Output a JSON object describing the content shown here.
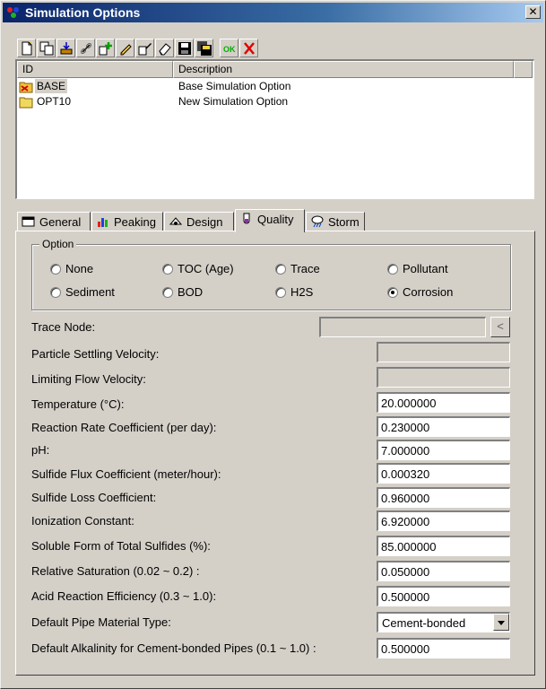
{
  "window": {
    "title": "Simulation Options",
    "close_label": "✕"
  },
  "toolbar": {
    "buttons": [
      {
        "icon": "new-icon"
      },
      {
        "icon": "copy-icon"
      },
      {
        "icon": "import-icon"
      },
      {
        "icon": "link-icon"
      },
      {
        "icon": "add-icon"
      },
      {
        "icon": "edit-icon"
      },
      {
        "icon": "rename-icon"
      },
      {
        "icon": "erase-icon"
      },
      {
        "icon": "save-icon"
      },
      {
        "icon": "save-all-icon"
      },
      {
        "icon": "ok-icon"
      },
      {
        "icon": "delete-icon"
      }
    ],
    "ok_label": "OK"
  },
  "list": {
    "columns": [
      "ID",
      "Description"
    ],
    "rows": [
      {
        "id": "BASE",
        "description": "Base Simulation Option",
        "icon": "base-folder-icon",
        "selected": true
      },
      {
        "id": "OPT10",
        "description": "New Simulation Option",
        "icon": "folder-icon",
        "selected": false
      }
    ]
  },
  "tabs": [
    {
      "label": "General",
      "icon": "general-icon"
    },
    {
      "label": "Peaking",
      "icon": "peaking-icon"
    },
    {
      "label": "Design",
      "icon": "design-icon"
    },
    {
      "label": "Quality",
      "icon": "quality-icon",
      "active": true
    },
    {
      "label": "Storm",
      "icon": "storm-icon"
    }
  ],
  "option_group": {
    "label": "Option",
    "options": [
      {
        "label": "None",
        "checked": false
      },
      {
        "label": "TOC (Age)",
        "checked": false
      },
      {
        "label": "Trace",
        "checked": false
      },
      {
        "label": "Pollutant",
        "checked": false
      },
      {
        "label": "Sediment",
        "checked": false
      },
      {
        "label": "BOD",
        "checked": false
      },
      {
        "label": "H2S",
        "checked": false
      },
      {
        "label": "Corrosion",
        "checked": true
      }
    ]
  },
  "trace_node": {
    "label": "Trace Node:",
    "value": "",
    "button_label": "<"
  },
  "fields": [
    {
      "label": "Particle Settling Velocity:",
      "value": "",
      "enabled": false
    },
    {
      "label": "Limiting Flow Velocity:",
      "value": "",
      "enabled": false
    },
    {
      "label": "Temperature (°C):",
      "value": "20.000000",
      "enabled": true
    },
    {
      "label": "Reaction Rate Coefficient (per day):",
      "value": "0.230000",
      "enabled": true
    },
    {
      "label": "pH:",
      "value": "7.000000",
      "enabled": true
    },
    {
      "label": "Sulfide Flux Coefficient (meter/hour):",
      "value": "0.000320",
      "enabled": true
    },
    {
      "label": "Sulfide Loss Coefficient:",
      "value": "0.960000",
      "enabled": true
    },
    {
      "label": "Ionization Constant:",
      "value": "6.920000",
      "enabled": true
    },
    {
      "label": "Soluble Form of Total Sulfides (%):",
      "value": "85.000000",
      "enabled": true
    },
    {
      "label": "Relative Saturation (0.02 ~ 0.2) :",
      "value": "0.050000",
      "enabled": true
    },
    {
      "label": "Acid Reaction Efficiency (0.3 ~ 1.0):",
      "value": "0.500000",
      "enabled": true
    }
  ],
  "pipe_material": {
    "label": "Default Pipe Material Type:",
    "value": "Cement-bonded"
  },
  "alkalinity": {
    "label": "Default Alkalinity for Cement-bonded Pipes (0.1 ~ 1.0) :",
    "value": "0.500000"
  }
}
